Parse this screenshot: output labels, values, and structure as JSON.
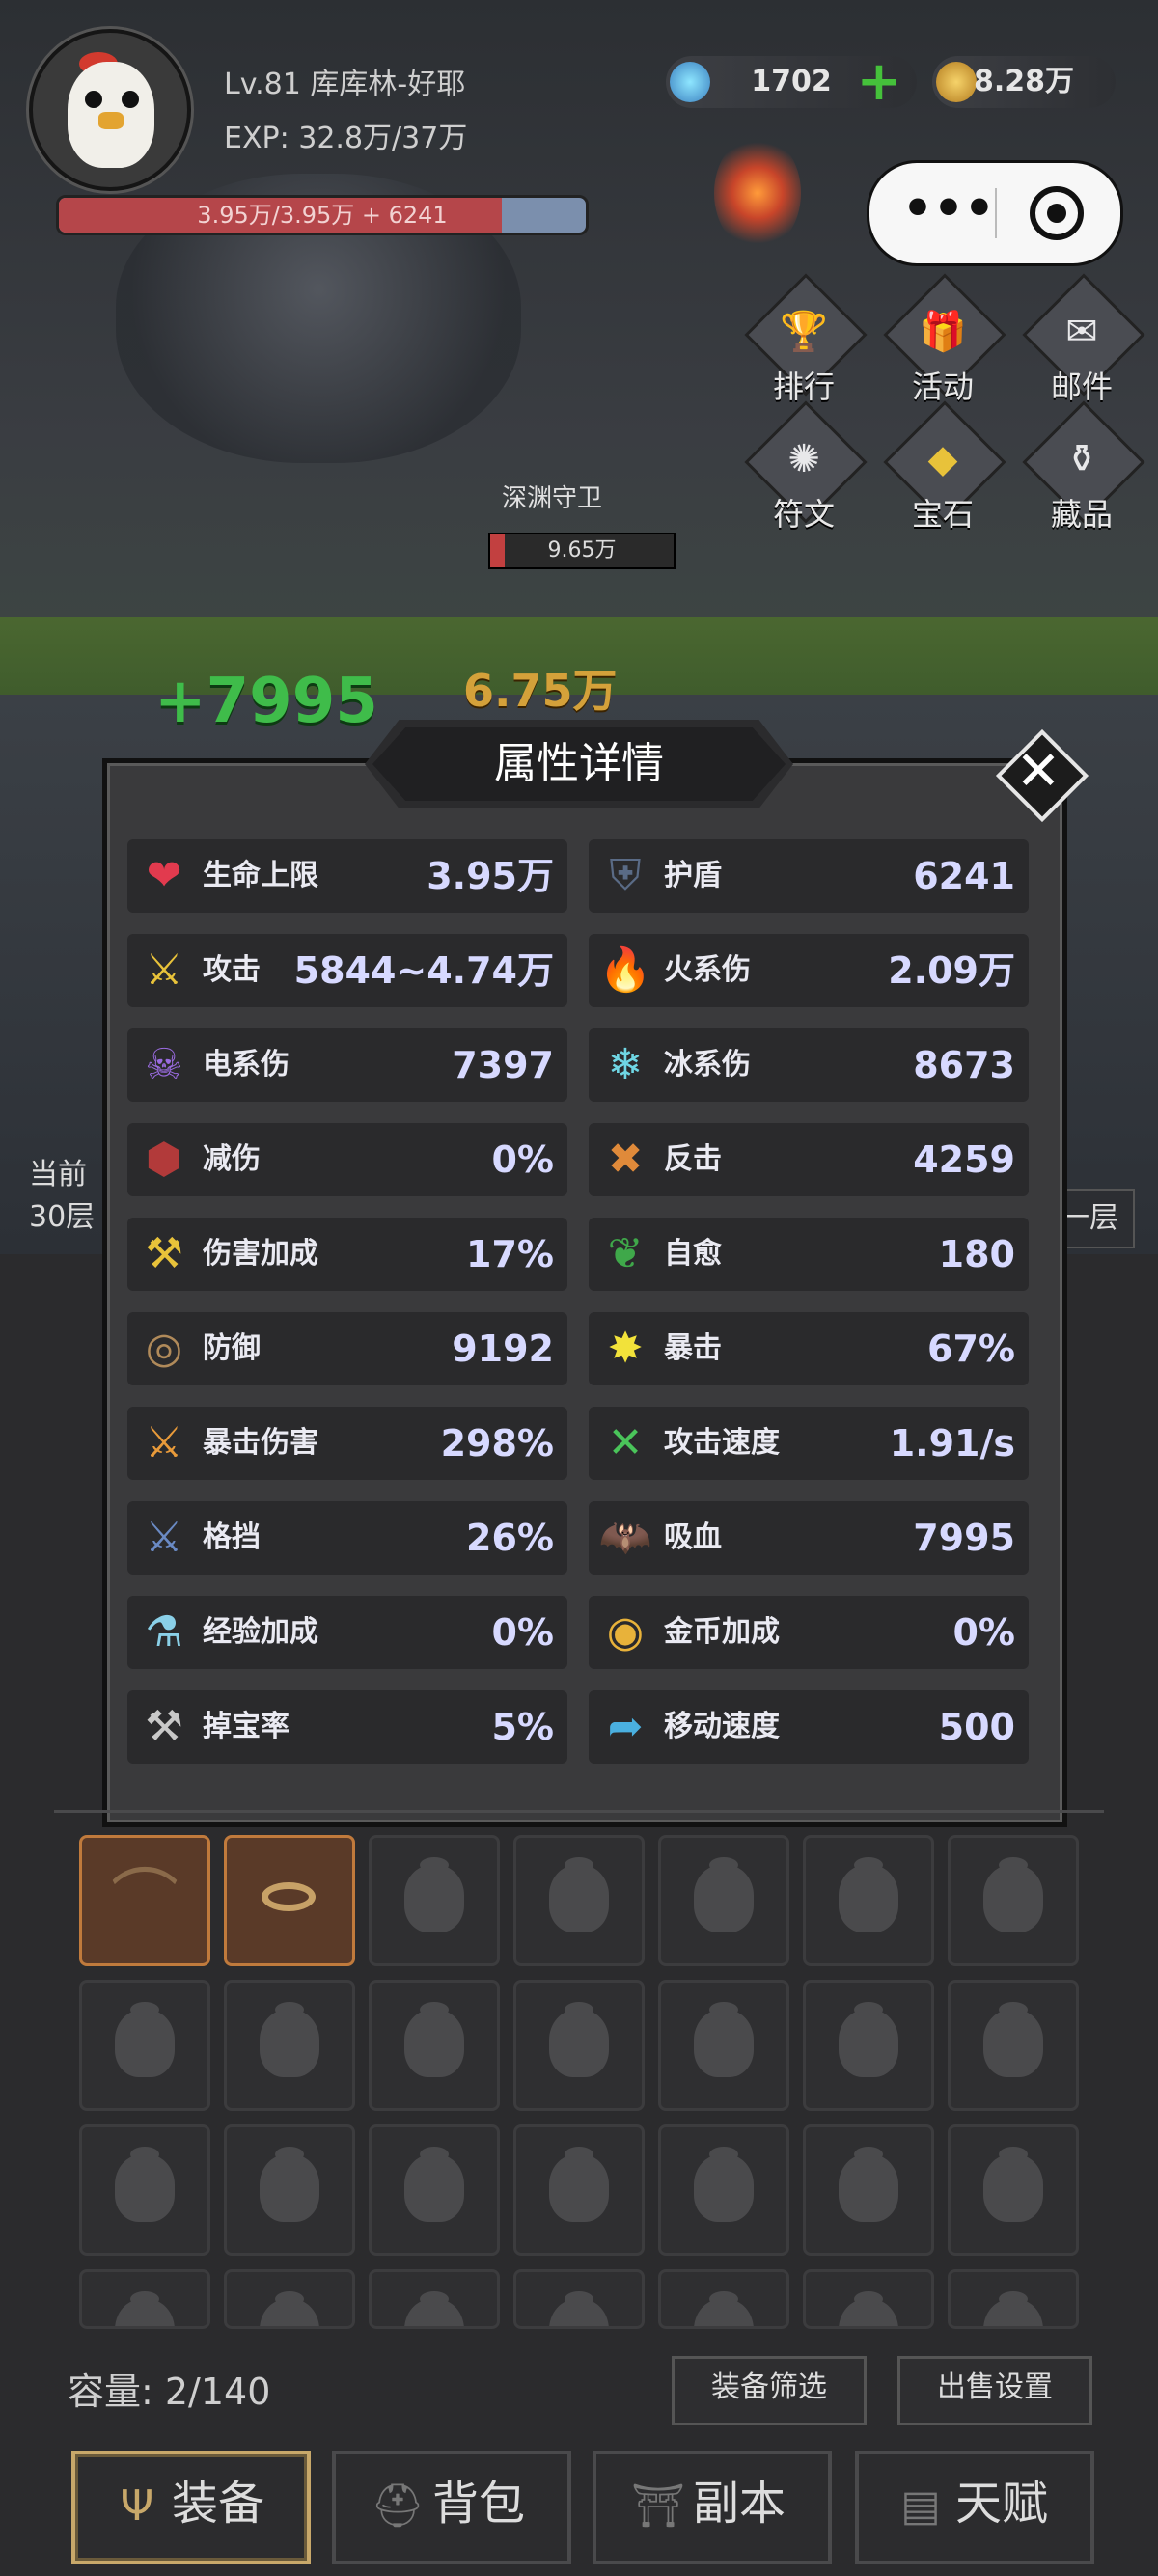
{
  "player": {
    "level_name": "Lv.81 库库林-好耶",
    "exp": "EXP: 32.8万/37万",
    "hp_text": "3.95万/3.95万 + 6241",
    "hp_fraction": 0.84
  },
  "resources": {
    "gems": "1702",
    "coins": "8.28万"
  },
  "menu": [
    {
      "label": "排行",
      "icon": "trophy-icon"
    },
    {
      "label": "活动",
      "icon": "chest-icon"
    },
    {
      "label": "邮件",
      "icon": "mail-icon"
    },
    {
      "label": "符文",
      "icon": "rune-icon"
    },
    {
      "label": "宝石",
      "icon": "gem-crystal-icon"
    },
    {
      "label": "藏品",
      "icon": "collection-icon"
    }
  ],
  "boss": {
    "name": "深渊守卫",
    "hp": "9.65万",
    "hp_fraction": 0.08
  },
  "damage": {
    "heal": "+7995",
    "hit": "6.75万"
  },
  "floor": {
    "current_label": "当前",
    "current_floor": "30层",
    "right_label": "一层"
  },
  "modal": {
    "title": "属性详情",
    "stats": [
      {
        "name": "生命上限",
        "value": "3.95万",
        "icon": "heart-icon",
        "color": "#e23a4e",
        "glyph": "❤"
      },
      {
        "name": "护盾",
        "value": "6241",
        "icon": "shield-icon",
        "color": "#5a6b86",
        "glyph": "⛨"
      },
      {
        "name": "攻击",
        "value": "5844~4.74万",
        "icon": "sword-icon",
        "color": "#e8c23a",
        "glyph": "⚔"
      },
      {
        "name": "火系伤",
        "value": "2.09万",
        "icon": "fire-icon",
        "color": "#e2552a",
        "glyph": "🔥"
      },
      {
        "name": "电系伤",
        "value": "7397",
        "icon": "lightning-skull-icon",
        "color": "#9a6be0",
        "glyph": "☠"
      },
      {
        "name": "冰系伤",
        "value": "8673",
        "icon": "snowflake-icon",
        "color": "#6fd6e4",
        "glyph": "❄"
      },
      {
        "name": "减伤",
        "value": "0%",
        "icon": "damage-reduce-icon",
        "color": "#b23a3a",
        "glyph": "⬢"
      },
      {
        "name": "反击",
        "value": "4259",
        "icon": "crossed-swords-icon",
        "color": "#e08a3a",
        "glyph": "✖"
      },
      {
        "name": "伤害加成",
        "value": "17%",
        "icon": "axe-icon",
        "color": "#e8c23a",
        "glyph": "⚒"
      },
      {
        "name": "自愈",
        "value": "180",
        "icon": "leaf-icon",
        "color": "#3fa84a",
        "glyph": "❦"
      },
      {
        "name": "防御",
        "value": "9192",
        "icon": "round-shield-icon",
        "color": "#b08a5a",
        "glyph": "◎"
      },
      {
        "name": "暴击",
        "value": "67%",
        "icon": "crit-burst-icon",
        "color": "#f2e23a",
        "glyph": "✸"
      },
      {
        "name": "暴击伤害",
        "value": "298%",
        "icon": "triple-sword-icon",
        "color": "#e89a3a",
        "glyph": "⚔"
      },
      {
        "name": "攻击速度",
        "value": "1.91/s",
        "icon": "cross-arrows-icon",
        "color": "#4ac45a",
        "glyph": "✕"
      },
      {
        "name": "格挡",
        "value": "26%",
        "icon": "block-sword-icon",
        "color": "#6a8ac4",
        "glyph": "⚔"
      },
      {
        "name": "吸血",
        "value": "7995",
        "icon": "bat-icon",
        "color": "#d0343e",
        "glyph": "🦇"
      },
      {
        "name": "经验加成",
        "value": "0%",
        "icon": "exp-potion-icon",
        "color": "#8ad0e8",
        "glyph": "⚗"
      },
      {
        "name": "金币加成",
        "value": "0%",
        "icon": "coin-up-icon",
        "color": "#e8b23a",
        "glyph": "◉"
      },
      {
        "name": "掉宝率",
        "value": "5%",
        "icon": "loot-up-icon",
        "color": "#c8c8c8",
        "glyph": "⚒"
      },
      {
        "name": "移动速度",
        "value": "500",
        "icon": "boot-icon",
        "color": "#4ab0e0",
        "glyph": "➦"
      }
    ]
  },
  "inventory": {
    "capacity": "容量: 2/140",
    "filter_button": "装备筛选",
    "sell_button": "出售设置"
  },
  "nav": [
    {
      "label": "装备",
      "icon": "trident-icon"
    },
    {
      "label": "背包",
      "icon": "backpack-icon"
    },
    {
      "label": "副本",
      "icon": "gate-icon"
    },
    {
      "label": "天赋",
      "icon": "talent-card-icon"
    }
  ]
}
